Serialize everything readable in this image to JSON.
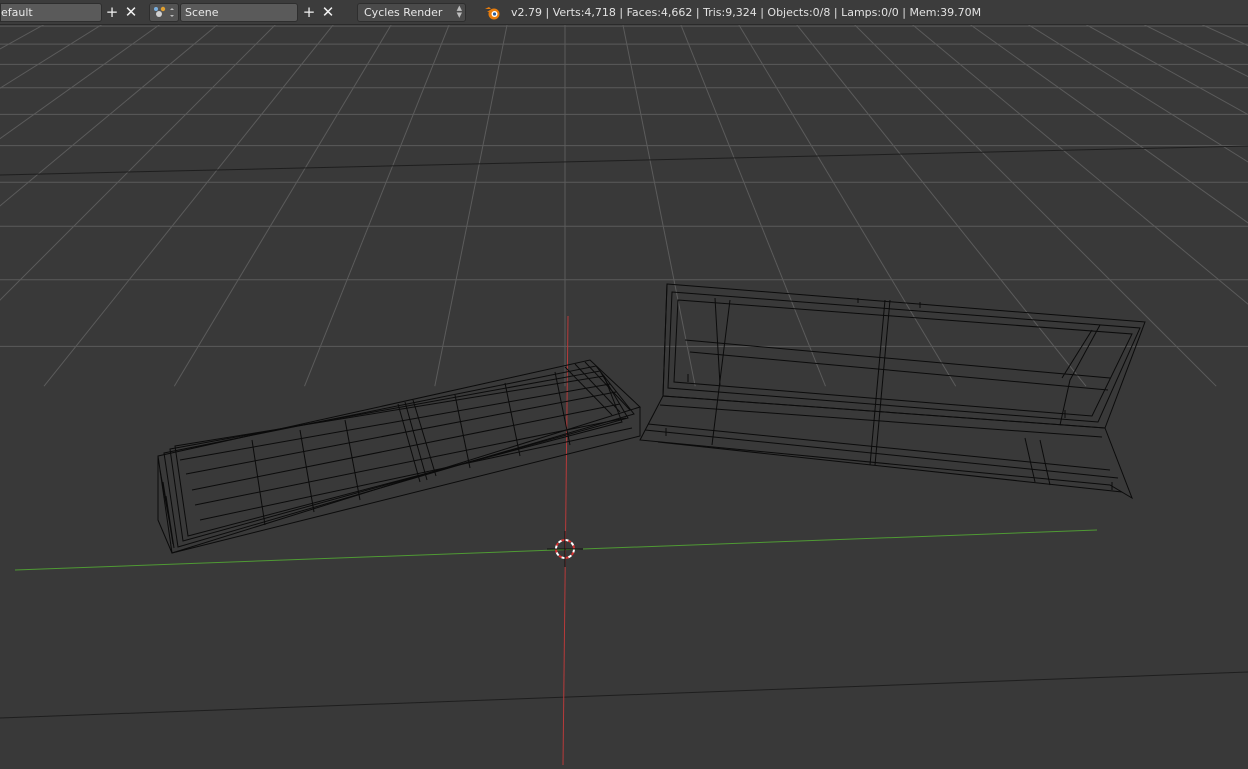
{
  "header": {
    "screen_layout": {
      "name": "efault",
      "add_label": "+",
      "remove_label": "✕"
    },
    "scene": {
      "name": "Scene",
      "add_label": "+",
      "remove_label": "✕"
    },
    "render_engine": {
      "selected": "Cycles Render"
    },
    "stats": "v2.79 | Verts:4,718 | Faces:4,662 | Tris:9,324 | Objects:0/8 | Lamps:0/0 | Mem:39.70M"
  },
  "viewport": {
    "mode": "wireframe",
    "colors": {
      "background": "#393939",
      "grid": "#5b5b5b",
      "x_axis": "#b83a3a",
      "y_axis": "#4f9a34",
      "wire": "#0b0b0b"
    },
    "icons": [
      "3d-cursor-icon",
      "blender-logo-icon",
      "scene-type-icon"
    ]
  }
}
